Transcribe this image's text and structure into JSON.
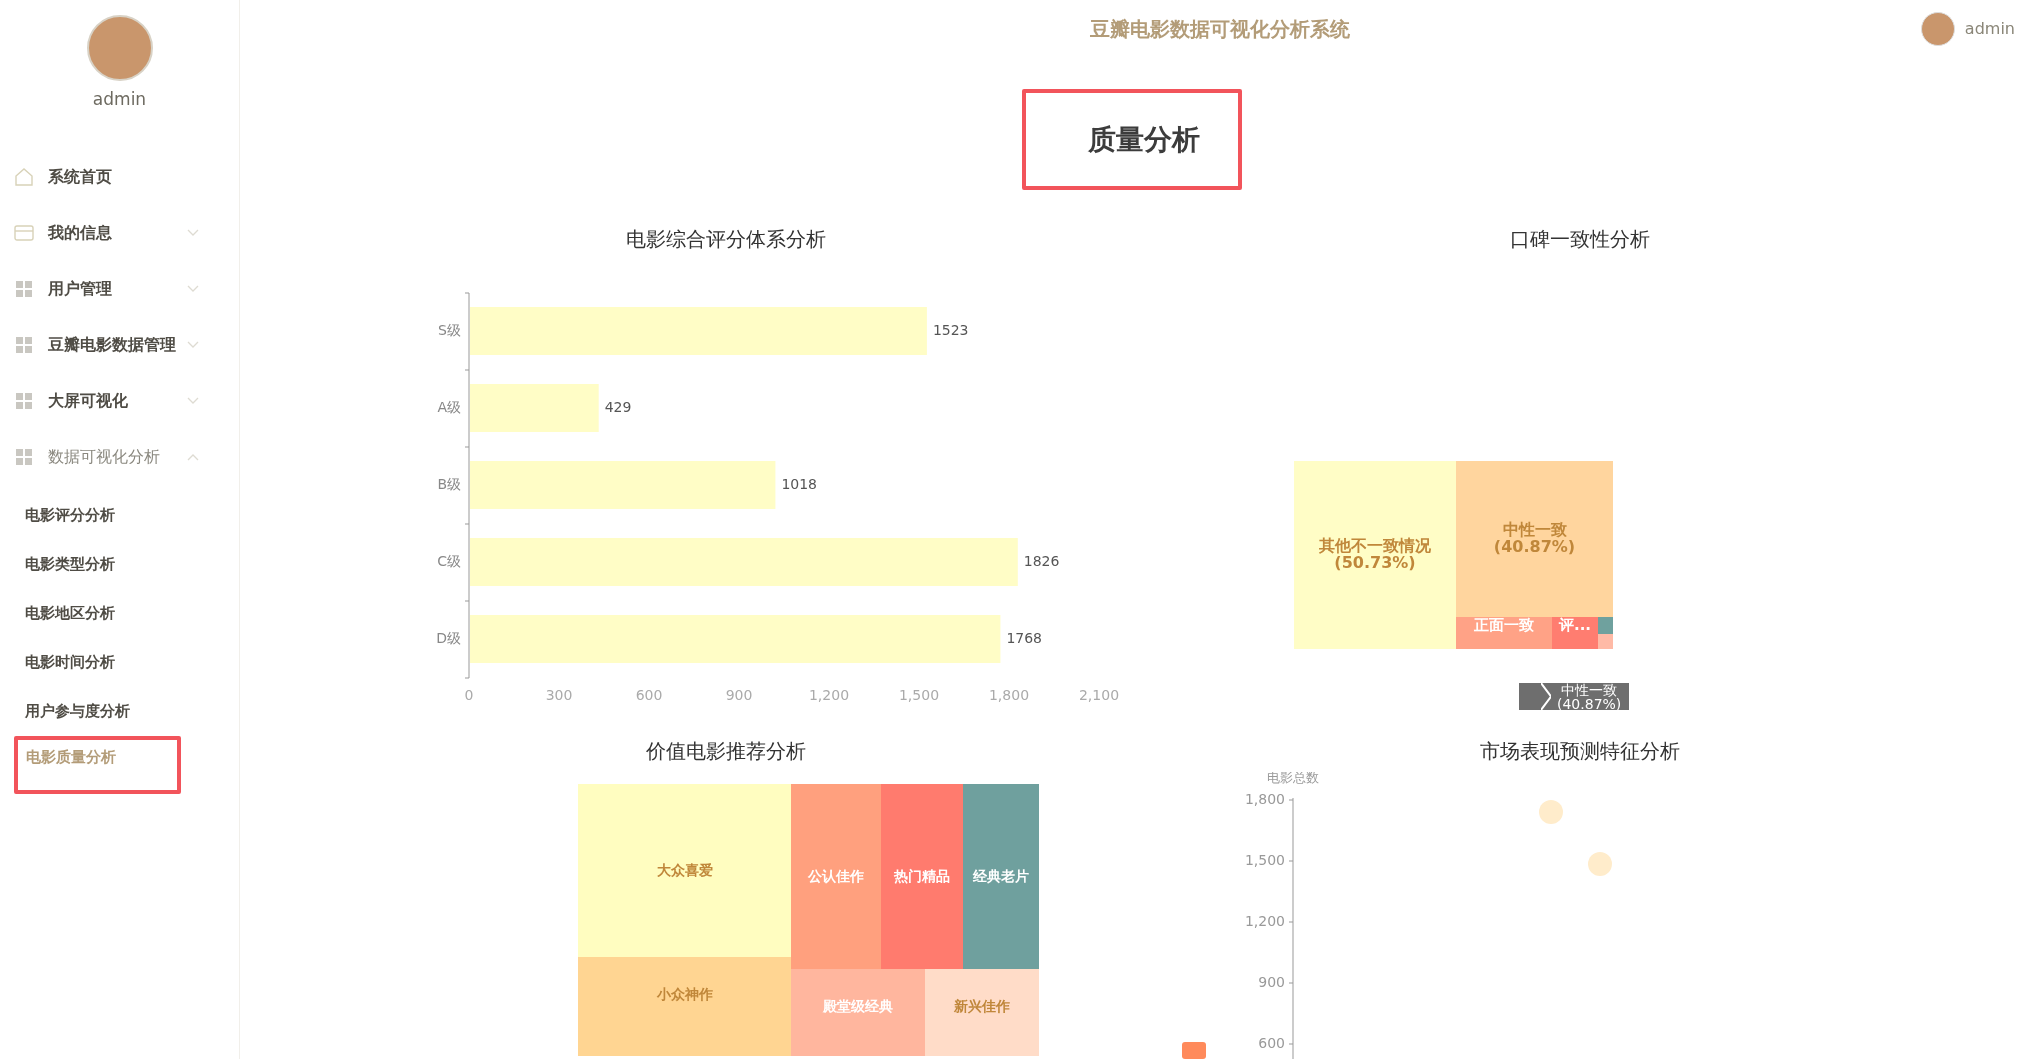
{
  "header": {
    "title": "豆瓣电影数据可视化分析系统",
    "user": "admin"
  },
  "sidebar": {
    "user": "admin",
    "items": [
      {
        "label": "系统首页",
        "kind": "home"
      },
      {
        "label": "我的信息",
        "kind": "card",
        "expanded": false
      },
      {
        "label": "用户管理",
        "kind": "grid",
        "expanded": false
      },
      {
        "label": "豆瓣电影数据管理",
        "kind": "grid",
        "expanded": false
      },
      {
        "label": "大屏可视化",
        "kind": "grid",
        "expanded": false
      },
      {
        "label": "数据可视化分析",
        "kind": "grid",
        "expanded": true,
        "children": [
          {
            "label": "电影评分分析",
            "selected": false
          },
          {
            "label": "电影类型分析",
            "selected": false
          },
          {
            "label": "电影地区分析",
            "selected": false
          },
          {
            "label": "电影时间分析",
            "selected": false
          },
          {
            "label": "用户参与度分析",
            "selected": false
          },
          {
            "label": "电影质量分析",
            "selected": true
          }
        ]
      }
    ]
  },
  "page_title": "质量分析",
  "charts": [
    {
      "title": "电影综合评分体系分析",
      "chart_data": {
        "type": "bar",
        "orientation": "horizontal",
        "categories": [
          "S级",
          "A级",
          "B级",
          "C级",
          "D级"
        ],
        "values": [
          1523,
          429,
          1018,
          1826,
          1768
        ],
        "xlim": [
          0,
          2100
        ],
        "xticks": [
          0,
          300,
          600,
          900,
          {
            "value": 1200,
            "label": "1,200"
          },
          {
            "value": 1500,
            "label": "1,500"
          },
          {
            "value": 1800,
            "label": "1,800"
          },
          {
            "value": 2100,
            "label": "2,100"
          }
        ],
        "data_labels": true
      }
    },
    {
      "title": "口碑一致性分析",
      "tiles": [
        {
          "label": "其他不一致情况",
          "percent": "(50.73%)",
          "color": "#fffdc6"
        },
        {
          "label": "中性一致",
          "percent": "(40.87%)",
          "color": "#ffd59e"
        },
        {
          "label": "正面一致",
          "color": "#ffa286"
        },
        {
          "label": "评...",
          "color": "#ff7d70"
        },
        {
          "color": "#6fa19e"
        },
        {
          "color": "#ffbaa6"
        }
      ],
      "breadcrumb": {
        "label": "中性一致",
        "percent": "(40.87%)"
      }
    },
    {
      "title": "价值电影推荐分析",
      "tiles": [
        {
          "label": "大众喜爱",
          "color": "#fffdc0"
        },
        {
          "label": "小众神作",
          "color": "#ffd592"
        },
        {
          "label": "公认佳作",
          "color": "#ffa07e"
        },
        {
          "label": "热门精品",
          "color": "#ff7b6e"
        },
        {
          "label": "经典老片",
          "color": "#6fa09e"
        },
        {
          "label": "殿堂级经典",
          "color": "#ffb69e"
        },
        {
          "label": "新兴佳作",
          "color": "#ffdcc8"
        }
      ]
    },
    {
      "title": "市场表现预测特征分析",
      "y_axis": {
        "title": "电影总数",
        "ticks": [
          "1,800",
          "1,500",
          "1,200",
          "900",
          "600"
        ]
      }
    }
  ]
}
